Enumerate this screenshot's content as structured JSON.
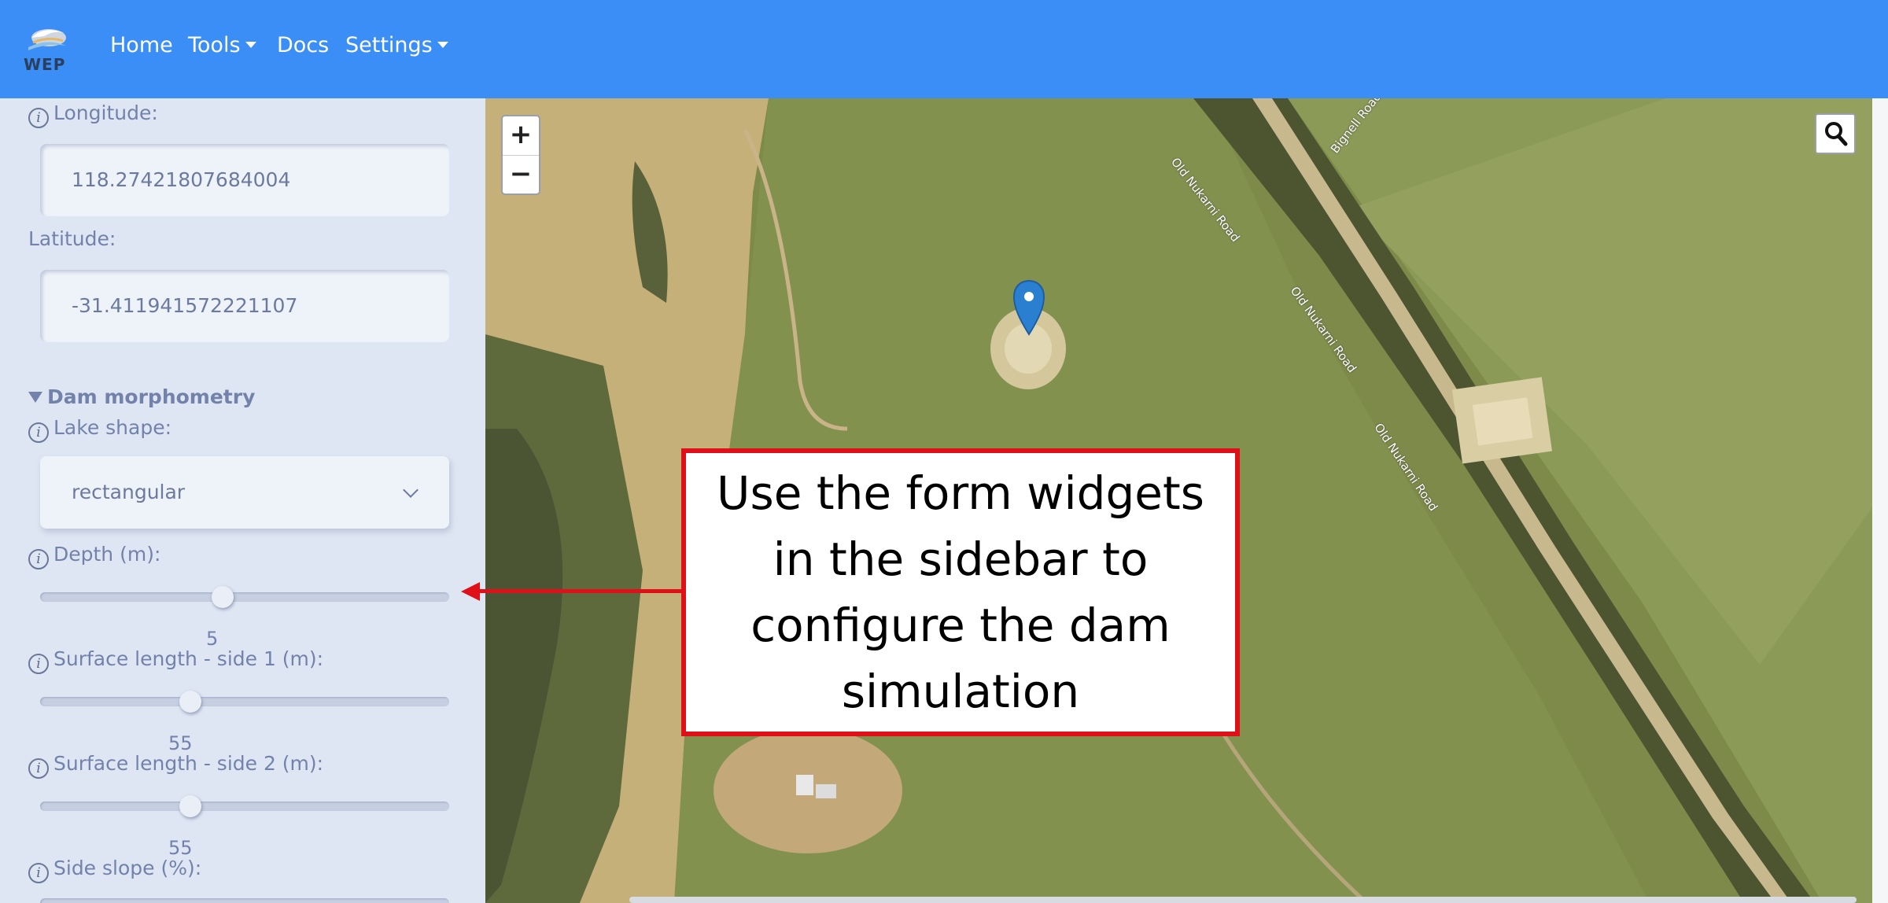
{
  "navbar": {
    "logo_text": "WEP",
    "items": [
      {
        "label": "Home",
        "dropdown": false
      },
      {
        "label": "Tools",
        "dropdown": true
      },
      {
        "label": "Docs",
        "dropdown": false
      },
      {
        "label": "Settings",
        "dropdown": true
      }
    ],
    "bg_color": "#3a8ef5"
  },
  "sidebar": {
    "longitude_label": "Longitude:",
    "longitude_value": "118.27421807684004",
    "latitude_label": "Latitude:",
    "latitude_value": "-31.411941572221107",
    "section_title": "Dam morphometry",
    "lake_shape_label": "Lake shape:",
    "lake_shape_value": "rectangular",
    "depth_label": "Depth (m):",
    "depth_value": "5",
    "side1_label": "Surface length - side 1 (m):",
    "side1_value": "55",
    "side2_label": "Surface length - side 2 (m):",
    "side2_value": "55",
    "slope_label": "Side slope (%):",
    "info_glyph": "i"
  },
  "map": {
    "zoom_in": "+",
    "zoom_out": "−",
    "search_icon": "search-icon",
    "roads": [
      "Old Nukarni Road",
      "Old Nukarni Road",
      "Old Nukarni Road",
      "Bignell Road"
    ]
  },
  "callout": {
    "text": "Use the form widgets in the sidebar to configure the dam simulation",
    "border_color": "#e0101a"
  }
}
